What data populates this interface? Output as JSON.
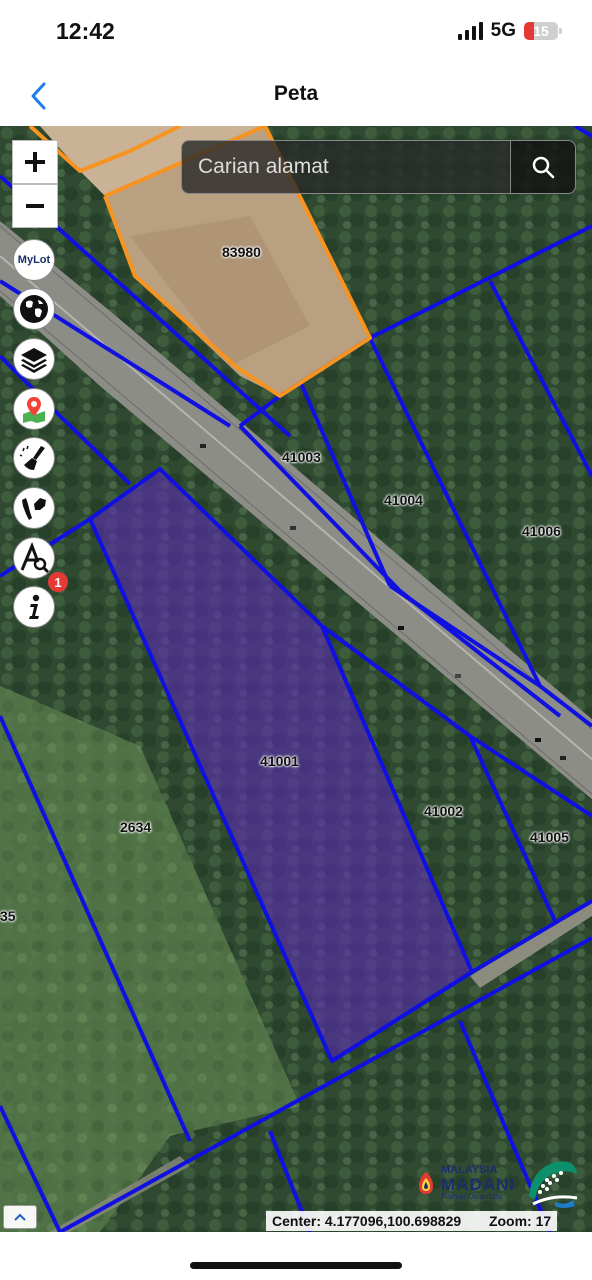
{
  "status": {
    "time": "12:42",
    "network": "5G",
    "battery": "15"
  },
  "nav": {
    "title": "Peta"
  },
  "search": {
    "placeholder": "Carian alamat"
  },
  "map": {
    "lots": [
      "83980",
      "41003",
      "41004",
      "41006",
      "41001",
      "2634",
      "41002",
      "41005",
      "35"
    ],
    "tools": [
      "mylot-icon",
      "globe-icon",
      "layers-icon",
      "map-marker-icon",
      "eraser-icon",
      "malaysia-map-icon",
      "measure-icon",
      "info-icon"
    ],
    "mylot_text": "MyLot",
    "info_badge": "1",
    "highlight_color": "#5b2bb0",
    "boundary_color": "#1010e0",
    "selection_color": "#f7931e",
    "logos": {
      "madani_line1": "MALAYSIA",
      "madani_line2": "MADANI",
      "madani_tag": "Rakyat Disantuni"
    },
    "center_label": "Center: 4.177096,100.698829",
    "zoom_label": "Zoom: 17"
  }
}
